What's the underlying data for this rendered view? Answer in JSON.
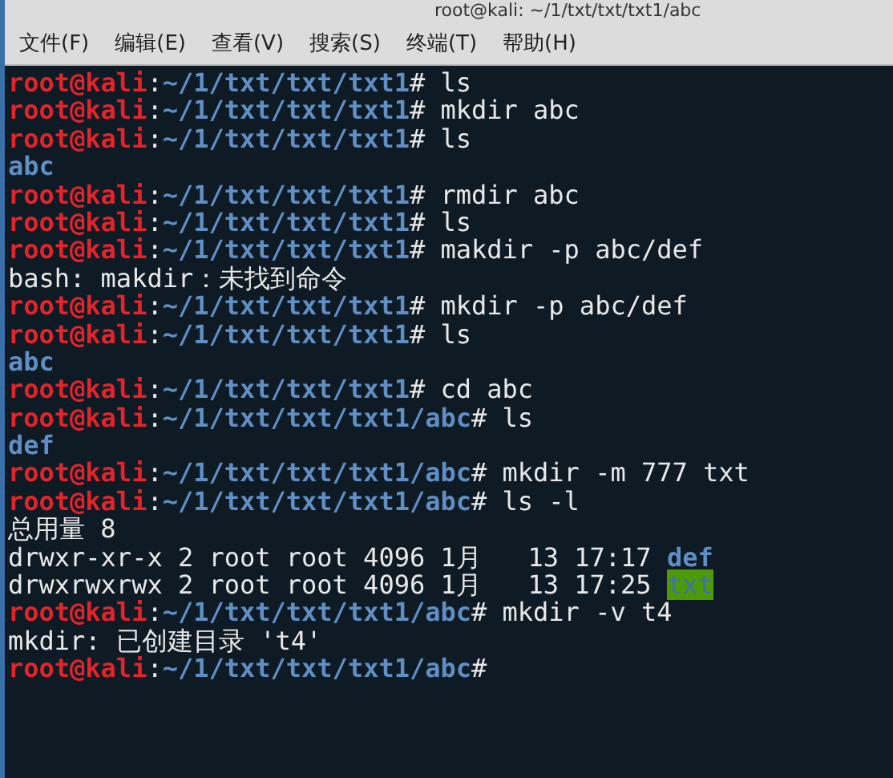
{
  "window": {
    "title": "root@kali: ~/1/txt/txt/txt1/abc"
  },
  "menu": [
    "文件(F)",
    "编辑(E)",
    "查看(V)",
    "搜索(S)",
    "终端(T)",
    "帮助(H)"
  ],
  "lines": [
    [
      {
        "kind": "user",
        "text": "root@kali"
      },
      {
        "kind": "plain",
        "text": ":"
      },
      {
        "kind": "path",
        "text": "~/1/txt/txt/txt1"
      },
      {
        "kind": "plain",
        "text": "# ls"
      }
    ],
    [
      {
        "kind": "user",
        "text": "root@kali"
      },
      {
        "kind": "plain",
        "text": ":"
      },
      {
        "kind": "path",
        "text": "~/1/txt/txt/txt1"
      },
      {
        "kind": "plain",
        "text": "# mkdir abc"
      }
    ],
    [
      {
        "kind": "user",
        "text": "root@kali"
      },
      {
        "kind": "plain",
        "text": ":"
      },
      {
        "kind": "path",
        "text": "~/1/txt/txt/txt1"
      },
      {
        "kind": "plain",
        "text": "# ls"
      }
    ],
    [
      {
        "kind": "dir",
        "text": "abc"
      }
    ],
    [
      {
        "kind": "user",
        "text": "root@kali"
      },
      {
        "kind": "plain",
        "text": ":"
      },
      {
        "kind": "path",
        "text": "~/1/txt/txt/txt1"
      },
      {
        "kind": "plain",
        "text": "# rmdir abc"
      }
    ],
    [
      {
        "kind": "user",
        "text": "root@kali"
      },
      {
        "kind": "plain",
        "text": ":"
      },
      {
        "kind": "path",
        "text": "~/1/txt/txt/txt1"
      },
      {
        "kind": "plain",
        "text": "# ls"
      }
    ],
    [
      {
        "kind": "user",
        "text": "root@kali"
      },
      {
        "kind": "plain",
        "text": ":"
      },
      {
        "kind": "path",
        "text": "~/1/txt/txt/txt1"
      },
      {
        "kind": "plain",
        "text": "# makdir -p abc/def"
      }
    ],
    [
      {
        "kind": "plain",
        "text": "bash: makdir：未找到命令"
      }
    ],
    [
      {
        "kind": "user",
        "text": "root@kali"
      },
      {
        "kind": "plain",
        "text": ":"
      },
      {
        "kind": "path",
        "text": "~/1/txt/txt/txt1"
      },
      {
        "kind": "plain",
        "text": "# mkdir -p abc/def"
      }
    ],
    [
      {
        "kind": "user",
        "text": "root@kali"
      },
      {
        "kind": "plain",
        "text": ":"
      },
      {
        "kind": "path",
        "text": "~/1/txt/txt/txt1"
      },
      {
        "kind": "plain",
        "text": "# ls"
      }
    ],
    [
      {
        "kind": "dir",
        "text": "abc"
      }
    ],
    [
      {
        "kind": "user",
        "text": "root@kali"
      },
      {
        "kind": "plain",
        "text": ":"
      },
      {
        "kind": "path",
        "text": "~/1/txt/txt/txt1"
      },
      {
        "kind": "plain",
        "text": "# cd abc"
      }
    ],
    [
      {
        "kind": "user",
        "text": "root@kali"
      },
      {
        "kind": "plain",
        "text": ":"
      },
      {
        "kind": "path",
        "text": "~/1/txt/txt/txt1/abc"
      },
      {
        "kind": "plain",
        "text": "# ls"
      }
    ],
    [
      {
        "kind": "dir",
        "text": "def"
      }
    ],
    [
      {
        "kind": "user",
        "text": "root@kali"
      },
      {
        "kind": "plain",
        "text": ":"
      },
      {
        "kind": "path",
        "text": "~/1/txt/txt/txt1/abc"
      },
      {
        "kind": "plain",
        "text": "# mkdir -m 777 txt"
      }
    ],
    [
      {
        "kind": "user",
        "text": "root@kali"
      },
      {
        "kind": "plain",
        "text": ":"
      },
      {
        "kind": "path",
        "text": "~/1/txt/txt/txt1/abc"
      },
      {
        "kind": "plain",
        "text": "# ls -l"
      }
    ],
    [
      {
        "kind": "plain",
        "text": "总用量 8"
      }
    ],
    [
      {
        "kind": "plain",
        "text": "drwxr-xr-x 2 root root 4096 1月   13 17:17 "
      },
      {
        "kind": "dir",
        "text": "def"
      }
    ],
    [
      {
        "kind": "plain",
        "text": "drwxrwxrwx 2 root root 4096 1月   13 17:25 "
      },
      {
        "kind": "dir-writable",
        "text": "txt"
      }
    ],
    [
      {
        "kind": "user",
        "text": "root@kali"
      },
      {
        "kind": "plain",
        "text": ":"
      },
      {
        "kind": "path",
        "text": "~/1/txt/txt/txt1/abc"
      },
      {
        "kind": "plain",
        "text": "# mkdir -v t4"
      }
    ],
    [
      {
        "kind": "plain",
        "text": "mkdir: 已创建目录 't4'"
      }
    ],
    [
      {
        "kind": "user",
        "text": "root@kali"
      },
      {
        "kind": "plain",
        "text": ":"
      },
      {
        "kind": "path",
        "text": "~/1/txt/txt/txt1/abc"
      },
      {
        "kind": "plain",
        "text": "#"
      }
    ]
  ]
}
